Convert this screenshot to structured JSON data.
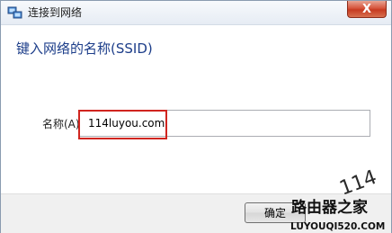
{
  "window": {
    "title": "连接到网络",
    "close_symbol": "X"
  },
  "heading": "键入网络的名称(SSID)",
  "field": {
    "label": "名称(A)",
    "value": "114luyou.com"
  },
  "buttons": {
    "ok": "确定"
  },
  "watermark": {
    "number": "114",
    "brand": "路由器之家",
    "url": "LUYOUQI520.COM"
  },
  "colors": {
    "heading": "#1d3e8a",
    "highlight": "#d0251f",
    "close_button": "#c63a20"
  }
}
